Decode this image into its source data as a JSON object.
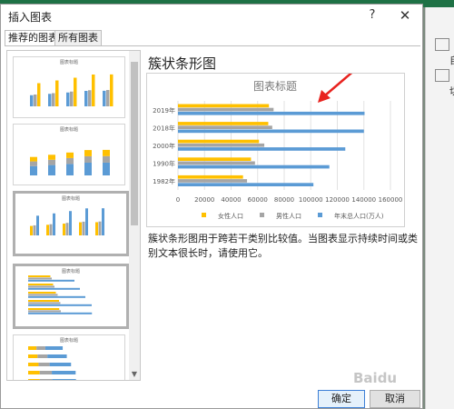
{
  "dialog": {
    "title": "插入图表",
    "help": "?",
    "close": "✕",
    "tabs": [
      "推荐的图表",
      "所有图表"
    ]
  },
  "thumbnails": {
    "title": "图表标题",
    "items": [
      {
        "kind": "clustered-column"
      },
      {
        "kind": "stacked-column"
      },
      {
        "kind": "clustered-column-legend"
      },
      {
        "kind": "clustered-bar",
        "selected": true
      },
      {
        "kind": "stacked-bar"
      }
    ]
  },
  "detail": {
    "name": "簇状条形图",
    "description": "簇状条形图用于跨若干类别比较值。当图表显示持续时间或类别文本很长时，请使用它。"
  },
  "chart_data": {
    "type": "bar",
    "orientation": "horizontal",
    "title": "图表标题",
    "categories": [
      "1982年",
      "1990年",
      "2000年",
      "2018年",
      "2019年"
    ],
    "series": [
      {
        "name": "女性人口",
        "color": "#ffc000",
        "values": [
          49000,
          55000,
          61000,
          68000,
          68500
        ]
      },
      {
        "name": "男性人口",
        "color": "#a5a5a5",
        "values": [
          52000,
          58000,
          65000,
          71000,
          72000
        ]
      },
      {
        "name": "年末总人口(万人)",
        "color": "#5b9bd5",
        "values": [
          102000,
          114000,
          126000,
          140000,
          140500
        ]
      }
    ],
    "xlim": [
      0,
      160000
    ],
    "xticks": [
      "0",
      "20000",
      "40000",
      "60000",
      "80000",
      "100000",
      "120000",
      "140000",
      "160000"
    ],
    "grid": true,
    "legend": "bottom",
    "annotation": "red-arrow"
  },
  "buttons": {
    "ok": "确定",
    "cancel": "取消"
  },
  "background": {
    "right_labels": [
      "自",
      "切"
    ]
  },
  "watermark": "Baidu"
}
